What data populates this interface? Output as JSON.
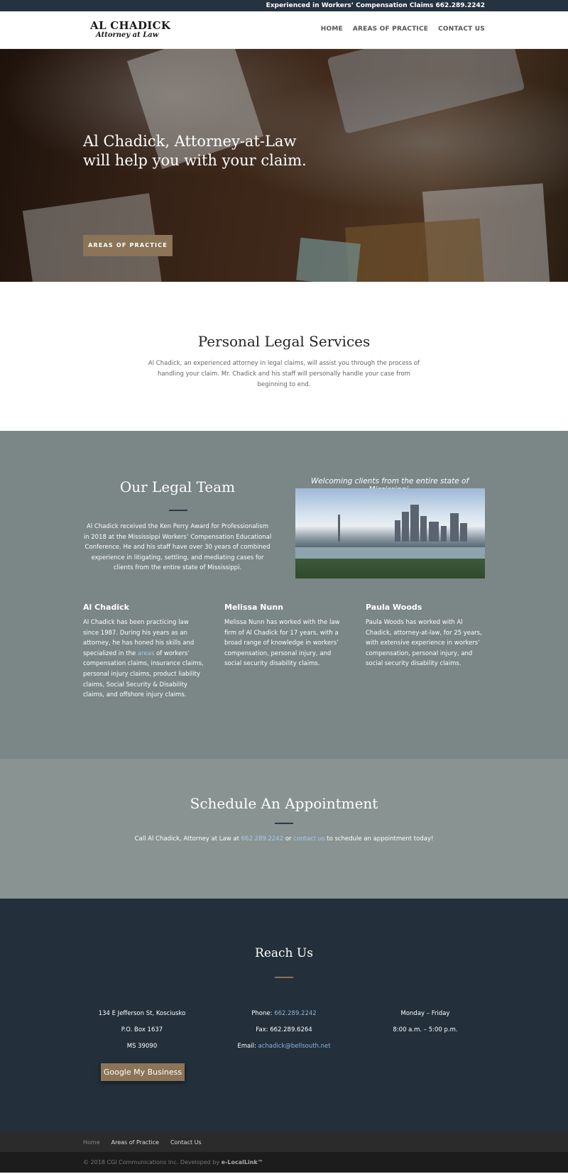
{
  "topbar": {
    "text": "Experienced in Workers’ Compensation Claims 662.289.2242"
  },
  "logo": {
    "line1": "AL CHADICK",
    "line2": "Attorney at Law"
  },
  "nav": {
    "home": "HOME",
    "areas": "AREAS OF PRACTICE",
    "contact": "CONTACT US"
  },
  "hero": {
    "headline": "Al Chadick, Attorney-at-Law will help you with your claim.",
    "button": "AREAS OF PRACTICE"
  },
  "services": {
    "title": "Personal Legal Services",
    "body": "Al Chadick, an experienced attorney in legal claims, will assist you through the process of handling your claim. Mr. Chadick and his staff will personally handle your case from beginning to end."
  },
  "team": {
    "title": "Our Legal Team",
    "award": "Al Chadick received the Ken Perry Award for Professionalism in 2018 at the Mississippi Workers’ Compensation Educational Conference. He and his staff have over 30 years of combined experience in litigating, settling, and mediating cases for clients from the entire state of Mississippi.",
    "welcome": "Welcoming clients from the entire state of Mississippi.",
    "members": [
      {
        "name": "Al Chadick",
        "bio_pre": "Al Chadick has been practicing law since 1987. During his years as an attorney, he has honed his skills and specialized in the ",
        "bio_link": "areas",
        "bio_post": " of workers’ compensation claims, insurance claims, personal injury claims, product liability claims, Social Security & Disability claims, and offshore injury claims."
      },
      {
        "name": "Melissa Nunn",
        "bio": "Melissa Nunn has worked with the law firm of Al Chadick for 17 years, with a broad range of knowledge in workers’ compensation, personal injury, and social security disability claims."
      },
      {
        "name": "Paula Woods",
        "bio": "Paula Woods has worked with Al Chadick, attorney-at-law, for 25 years, with extensive experience in workers’ compensation, personal injury, and social security disability claims."
      }
    ]
  },
  "appointment": {
    "title": "Schedule An Appointment",
    "text_pre": "Call Al Chadick, Attorney at Law at ",
    "phone": "662.289.2242",
    "text_mid": " or ",
    "contact_link": "contact us",
    "text_post": " to schedule an appointment today!"
  },
  "reach": {
    "title": "Reach Us",
    "address": [
      "134 E Jefferson St, Kosciusko",
      "P.O. Box 1637",
      "MS 39090"
    ],
    "phone_label": "Phone: ",
    "phone": "662.289.2242",
    "fax": "Fax: 662.289.6264",
    "email_label": "Email: ",
    "email": "achadick@bellsouth.net",
    "hours": [
      "Monday – Friday",
      "8:00 a.m. – 5:00 p.m."
    ],
    "gmb_button": "Google My Business"
  },
  "footer": {
    "nav": [
      "Home",
      "Areas of Practice",
      "Contact Us"
    ],
    "copy_pre": "© 2018 CGI Communications Inc. Developed by ",
    "copy_brand": "e-LocalLink™"
  },
  "colors": {
    "accent": "#8b7457",
    "dark_navy": "#232f3a",
    "team_bg": "#7a8786",
    "appt_bg": "#889392",
    "link": "#a9c9e8"
  }
}
